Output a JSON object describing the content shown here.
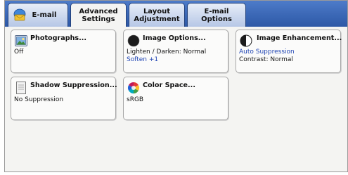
{
  "tabs": [
    {
      "label": "E-mail",
      "icon": "email-icon"
    },
    {
      "label": "Advanced\nSettings",
      "active": true
    },
    {
      "label": "Layout\nAdjustment"
    },
    {
      "label": "E-mail Options"
    }
  ],
  "cards": {
    "photographs": {
      "title": "Photographs...",
      "value": "Off",
      "icon": "photograph-icon"
    },
    "image_options": {
      "title": "Image Options...",
      "line1": "Lighten / Darken: Normal",
      "line2": "Soften +1",
      "icon": "image-options-icon"
    },
    "image_enhancement": {
      "title": "Image Enhancement...",
      "line1": "Auto Suppression",
      "line2": "Contrast: Normal",
      "icon": "image-enhancement-icon"
    },
    "shadow_suppression": {
      "title": "Shadow Suppression...",
      "value": "No Suppression",
      "icon": "shadow-suppression-icon"
    },
    "color_space": {
      "title": "Color Space...",
      "value": "sRGB",
      "icon": "color-space-icon"
    }
  },
  "colors": {
    "tab_bar": "#2d58a6",
    "accent_text": "#1f44b3"
  }
}
